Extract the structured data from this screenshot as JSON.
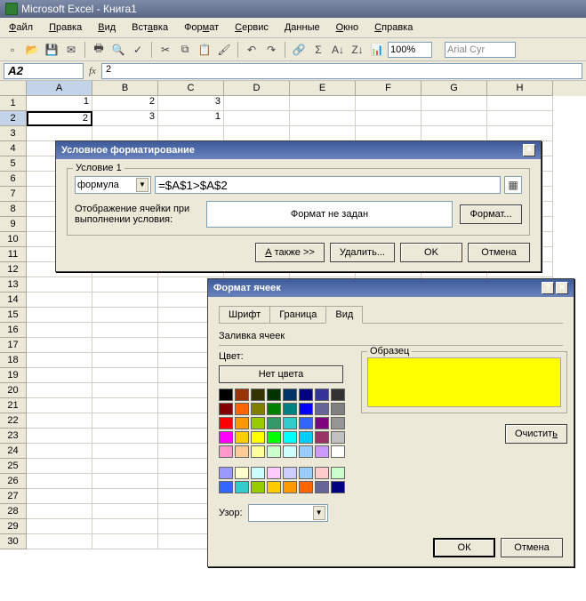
{
  "app": {
    "title": "Microsoft Excel - Книга1"
  },
  "menu": [
    "Файл",
    "Правка",
    "Вид",
    "Вставка",
    "Формат",
    "Сервис",
    "Данные",
    "Окно",
    "Справка"
  ],
  "toolbar": {
    "zoom": "100%",
    "font": "Arial Cyr"
  },
  "namebox": "A2",
  "formula": "2",
  "cols": [
    "A",
    "B",
    "C",
    "D",
    "E",
    "F",
    "G",
    "H"
  ],
  "rows": [
    "1",
    "2",
    "3",
    "4",
    "5",
    "6",
    "7",
    "8",
    "9",
    "10",
    "11",
    "12",
    "13",
    "14",
    "15",
    "16",
    "17",
    "18",
    "19",
    "20",
    "21",
    "22",
    "23",
    "24",
    "25",
    "26",
    "27",
    "28",
    "29",
    "30"
  ],
  "cells": {
    "A1": "1",
    "B1": "2",
    "C1": "3",
    "A2": "2",
    "B2": "3",
    "C2": "1"
  },
  "dlg1": {
    "title": "Условное форматирование",
    "cond_label": "Условие 1",
    "type": "формула",
    "formula": "=$A$1>$A$2",
    "preview_label1": "Отображение ячейки при",
    "preview_label2": "выполнении условия:",
    "preview_text": "Формат не задан",
    "btn_format": "Формат...",
    "btn_also": "А также >>",
    "btn_delete": "Удалить...",
    "btn_ok": "OK",
    "btn_cancel": "Отмена"
  },
  "dlg2": {
    "title": "Формат ячеек",
    "tabs": [
      "Шрифт",
      "Граница",
      "Вид"
    ],
    "active_tab": "Вид",
    "fill_label": "Заливка ячеек",
    "color_label": "Цвет:",
    "nocolor": "Нет цвета",
    "sample_label": "Образец",
    "pattern_label": "Узор:",
    "btn_clear": "Очистить",
    "btn_ok": "ОК",
    "btn_cancel": "Отмена",
    "palette_main": [
      "#000000",
      "#993300",
      "#333300",
      "#003300",
      "#003366",
      "#000080",
      "#333399",
      "#333333",
      "#800000",
      "#ff6600",
      "#808000",
      "#008000",
      "#008080",
      "#0000ff",
      "#666699",
      "#808080",
      "#ff0000",
      "#ff9900",
      "#99cc00",
      "#339966",
      "#33cccc",
      "#3366ff",
      "#800080",
      "#969696",
      "#ff00ff",
      "#ffcc00",
      "#ffff00",
      "#00ff00",
      "#00ffff",
      "#00ccff",
      "#993366",
      "#c0c0c0",
      "#ff99cc",
      "#ffcc99",
      "#ffff99",
      "#ccffcc",
      "#ccffff",
      "#99ccff",
      "#cc99ff",
      "#ffffff"
    ],
    "palette_extra": [
      "#9999ff",
      "#ffffcc",
      "#ccffff",
      "#ffccff",
      "#ccccff",
      "#99ccff",
      "#ffcccc",
      "#ccffcc",
      "#3366ff",
      "#33cccc",
      "#99cc00",
      "#ffcc00",
      "#ff9900",
      "#ff6600",
      "#666699",
      "#000080"
    ]
  },
  "chart_data": null
}
